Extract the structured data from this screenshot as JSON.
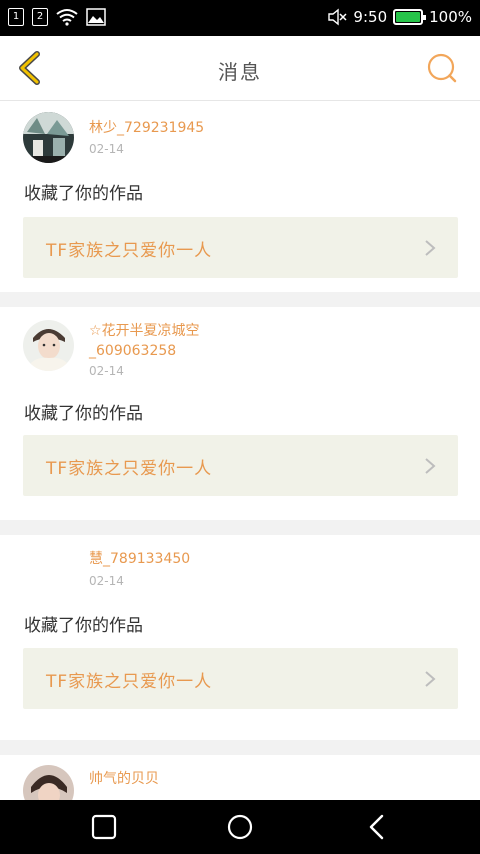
{
  "status_bar": {
    "sim1": "1",
    "sim2": "2",
    "time": "9:50",
    "battery": "100%",
    "battery_level": 1.0,
    "battery_color": "#27c44a"
  },
  "header": {
    "title": "消息",
    "accent_color": "#e8994f"
  },
  "messages": [
    {
      "user": "林少_729231945",
      "date": "02-14",
      "action": "收藏了你的作品",
      "work": "TF家族之只爱你一人"
    },
    {
      "user": "☆花开半夏凉城空_609063258",
      "date": "02-14",
      "action": "收藏了你的作品",
      "work": "TF家族之只爱你一人"
    },
    {
      "user": "慧_789133450",
      "date": "02-14",
      "action": "收藏了你的作品",
      "work": "TF家族之只爱你一人"
    },
    {
      "user": "帅气的贝贝"
    }
  ],
  "icons": {
    "back": "chevron-left-icon",
    "search": "search-icon",
    "recent": "square-icon",
    "home": "circle-icon",
    "nav_back": "triangle-back-icon"
  }
}
